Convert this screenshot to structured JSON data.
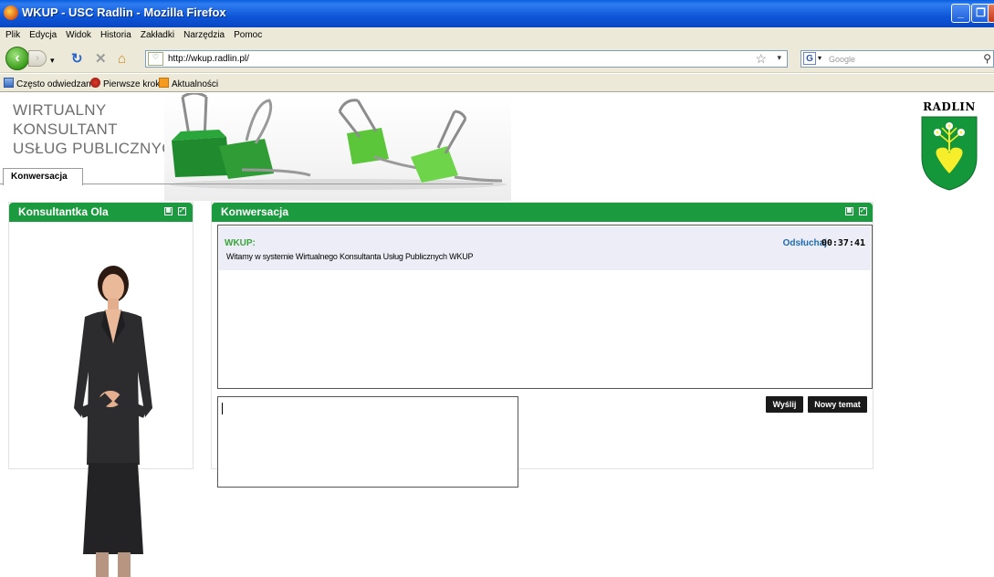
{
  "window": {
    "title": "WKUP - USC Radlin - Mozilla Firefox"
  },
  "menu": [
    "Plik",
    "Edycja",
    "Widok",
    "Historia",
    "Zakładki",
    "Narzędzia",
    "Pomoc"
  ],
  "nav": {
    "url": "http://wkup.radlin.pl/",
    "search_placeholder": "Google"
  },
  "bookmarks": [
    {
      "label": "Często odwiedzane",
      "icon": "bookmark-page-icon"
    },
    {
      "label": "Pierwsze kroki",
      "icon": "firefox-red-icon"
    },
    {
      "label": "Aktualności",
      "icon": "rss-feed-icon"
    }
  ],
  "site": {
    "logo_lines": [
      "WIRTUALNY",
      "KONSULTANT",
      "USŁUG PUBLICZNYCH"
    ],
    "tab": "Konwersacja",
    "city": "RADLIN"
  },
  "left_panel": {
    "title": "Konsultantka Ola"
  },
  "chat": {
    "title": "Konwersacja",
    "message": {
      "sender": "WKUP:",
      "listen": "Odsłuchaj",
      "time": "00:37:41",
      "text": "Witamy w systemie Wirtualnego Konsultanta Usług Publicznych WKUP"
    },
    "send": "Wyślij",
    "new_topic": "Nowy temat"
  },
  "colors": {
    "accent_green": "#1c9a3f",
    "titlebar_blue": "#0a5fe0"
  }
}
